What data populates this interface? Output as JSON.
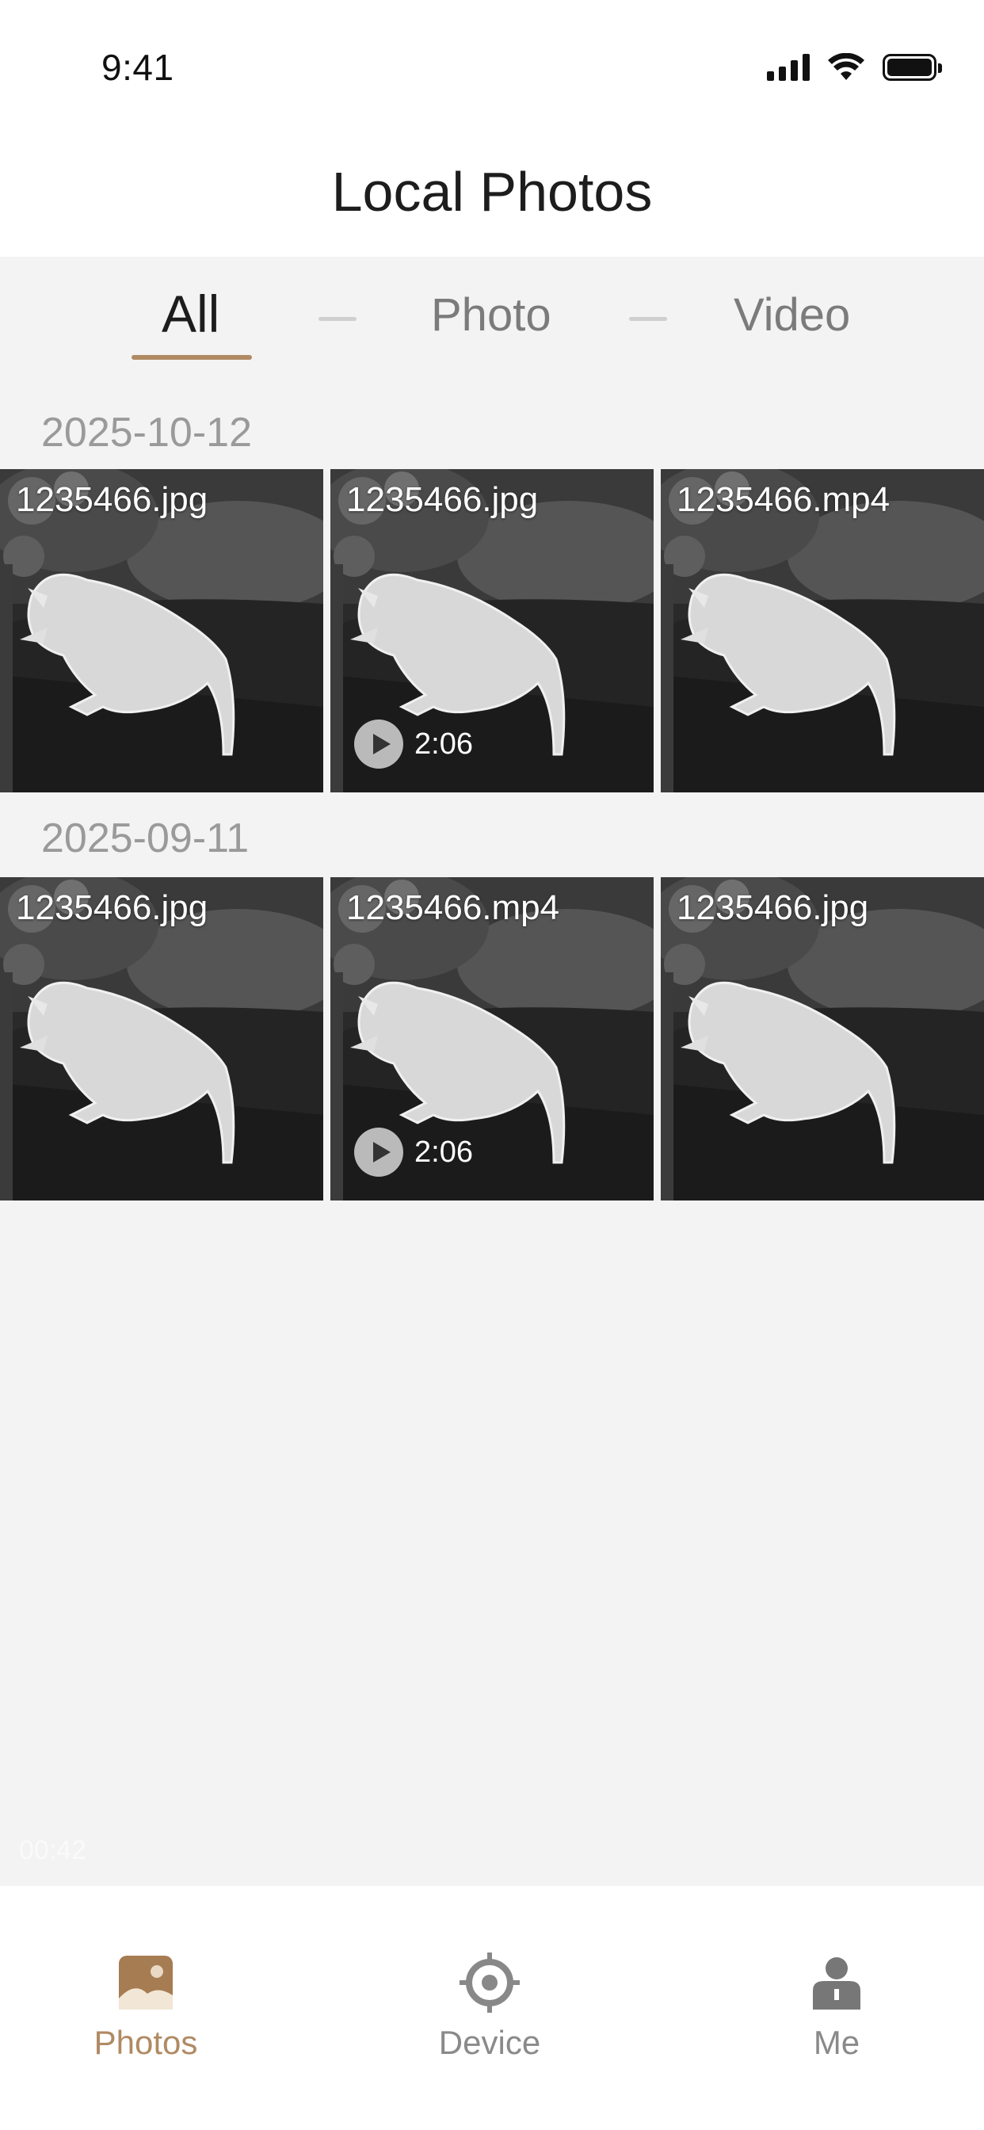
{
  "status_bar": {
    "time": "9:41"
  },
  "header": {
    "title": "Local Photos"
  },
  "tabs": [
    {
      "label": "All",
      "active": true
    },
    {
      "label": "Photo",
      "active": false
    },
    {
      "label": "Video",
      "active": false
    }
  ],
  "groups": [
    {
      "date": "2025-10-12",
      "items": [
        {
          "name": "1235466.jpg",
          "duration": ""
        },
        {
          "name": "1235466.jpg",
          "duration": "2:06"
        },
        {
          "name": "1235466.mp4",
          "duration": ""
        }
      ]
    },
    {
      "date": "2025-09-11",
      "items": [
        {
          "name": "1235466.jpg",
          "duration": ""
        },
        {
          "name": "1235466.mp4",
          "duration": "2:06"
        },
        {
          "name": "1235466.jpg",
          "duration": ""
        }
      ]
    }
  ],
  "overlay": {
    "faint_time": "00:42"
  },
  "bottom_nav": [
    {
      "label": "Photos",
      "icon": "photos-icon",
      "active": true
    },
    {
      "label": "Device",
      "icon": "crosshair-icon",
      "active": false
    },
    {
      "label": "Me",
      "icon": "person-icon",
      "active": false
    }
  ],
  "colors": {
    "accent": "#b08a63",
    "background": "#f3f3f3",
    "inactive_text": "#7b7b7b"
  }
}
